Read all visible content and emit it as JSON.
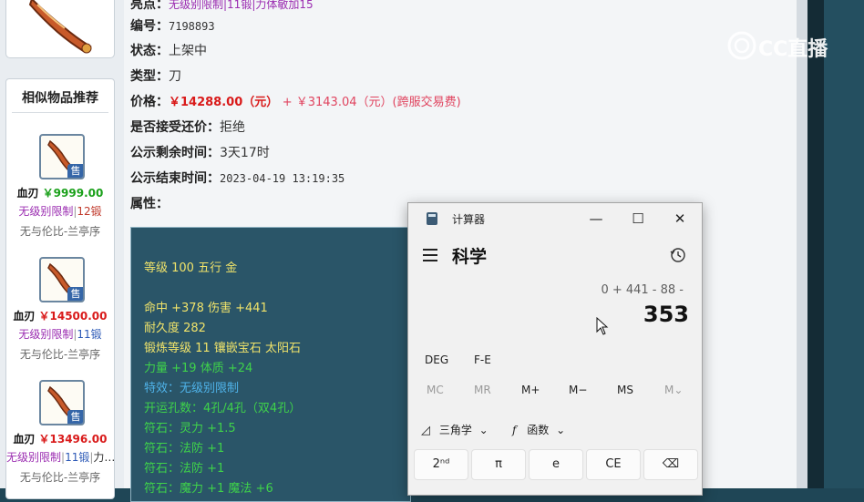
{
  "item_detail": {
    "cut_text": "无级别限制|11锻|力体敏加15",
    "rows": [
      {
        "label": "编号：",
        "value": "7198893"
      },
      {
        "label": "状态：",
        "value": "上架中"
      },
      {
        "label": "类型：",
        "value": "刀"
      },
      {
        "label": "价格：",
        "value": "￥14288.00（元）",
        "extra": "+ ￥3143.04（元）(跨服交易费)"
      },
      {
        "label": "是否接受还价：",
        "value": "拒绝"
      },
      {
        "label": "公示剩余时间：",
        "value": "3天17时"
      },
      {
        "label": "公示结束时间：",
        "value": "2023-04-19 13:19:35"
      },
      {
        "label": "属性：",
        "value": ""
      }
    ]
  },
  "attributes": [
    {
      "text": "等级 100 五行 金",
      "color": "#f0e36a"
    },
    {
      "text": "命中 +378 伤害 +441",
      "color": "#f0e36a"
    },
    {
      "text": "耐久度 282",
      "color": "#f0e36a"
    },
    {
      "text": "锻炼等级 11 镶嵌宝石 太阳石",
      "color": "#f0e36a"
    },
    {
      "text": "力量 +19 体质 +24",
      "color": "#3fd24a"
    },
    {
      "text": "特效：无级别限制",
      "color": "#4fb3ea"
    },
    {
      "text": "开运孔数：4孔/4孔（双4孔）",
      "color": "#3fd24a"
    },
    {
      "text": "符石：灵力 +1.5",
      "color": "#3fd24a"
    },
    {
      "text": "符石：法防 +1",
      "color": "#3fd24a"
    },
    {
      "text": "符石：法防 +1",
      "color": "#3fd24a"
    },
    {
      "text": "符石：魔力 +1 魔法 +6",
      "color": "#3fd24a"
    }
  ],
  "similar": {
    "title": "相似物品推荐",
    "badge": "售",
    "items": [
      {
        "name": "血刃",
        "price": "￥9999.00",
        "price_color": "#1aa01a",
        "tag": "无级别限制",
        "forge": "12锻",
        "forge_color": "#c0392b",
        "extra": "",
        "seller": "无与伦比-兰亭序"
      },
      {
        "name": "血刃",
        "price": "￥14500.00",
        "price_color": "#d91a1a",
        "tag": "无级别限制",
        "forge": "11锻",
        "forge_color": "#2d5ab7",
        "extra": "",
        "seller": "无与伦比-兰亭序"
      },
      {
        "name": "血刃",
        "price": "￥13496.00",
        "price_color": "#d91a1a",
        "tag": "无级别限制",
        "forge": "11锻",
        "forge_color": "#2d5ab7",
        "extra": "力…",
        "seller": "无与伦比-兰亭序"
      }
    ]
  },
  "calculator": {
    "title": "计算器",
    "mode": "科学",
    "expression": "0 + 441 - 88 -",
    "result": "353",
    "angle": "DEG",
    "fe": "F-E",
    "memory": [
      "MC",
      "MR",
      "M+",
      "M−",
      "MS",
      "M⌄"
    ],
    "trig": "三角学",
    "func": "函数",
    "keys": [
      "2ⁿᵈ",
      "π",
      "e",
      "CE",
      "⌫"
    ]
  },
  "watermark": "CC直播"
}
